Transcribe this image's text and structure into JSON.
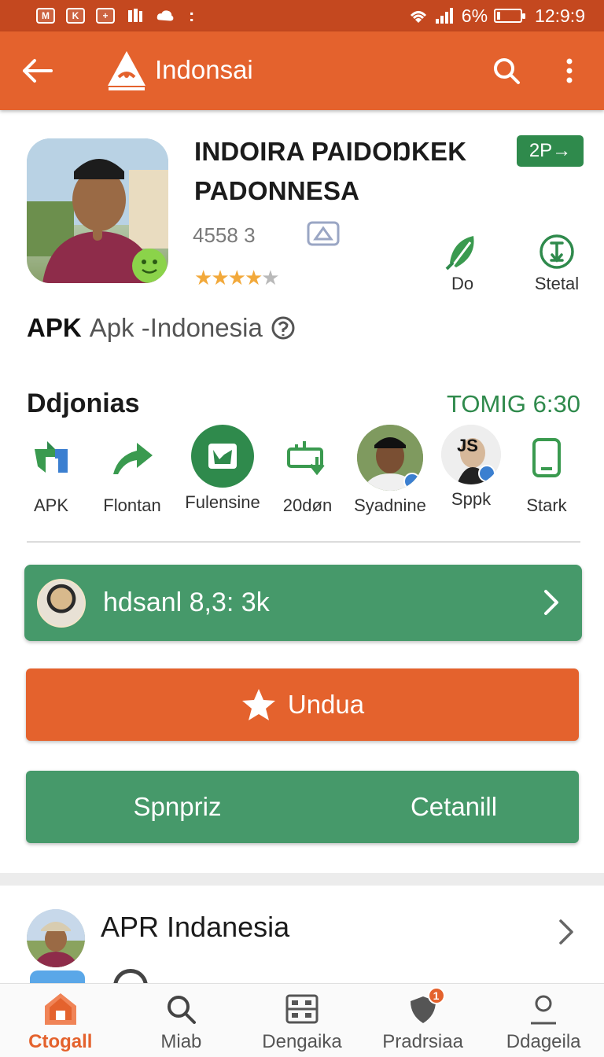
{
  "status_bar": {
    "time": "12:9:9",
    "battery": "6%",
    "left_icons": [
      "mail-icon",
      "calendar-icon",
      "plus-box-icon",
      "bookmark-icon",
      "cloud-icon"
    ],
    "more": ":"
  },
  "app_bar": {
    "title": "Indonsai",
    "back_icon": "arrow-left-icon",
    "search_icon": "search-icon",
    "more_icon": "more-vertical-icon"
  },
  "app": {
    "title": "INDOIRA PAIDOŊKEK PADONNESA",
    "badge": "2P→",
    "count": "4558 3",
    "rating_stars": 4,
    "rating_max": 5,
    "actions": [
      {
        "label": "Do",
        "icon": "leaf-pen-icon"
      },
      {
        "label": "Stetal",
        "icon": "install-circle-icon"
      }
    ]
  },
  "apk_line": {
    "bold": "APK",
    "text": "Apk -Indonesia"
  },
  "section": {
    "title": "Ddjonias",
    "time": "TOMIG 6:30",
    "shortcuts": [
      {
        "label": "APK",
        "icon": "apk-icon"
      },
      {
        "label": "Flontan",
        "icon": "share-arrow-icon"
      },
      {
        "label": "Fulensine",
        "icon": "image-circle-icon"
      },
      {
        "label": "20døn",
        "icon": "download-tray-icon"
      },
      {
        "label": "Syadnine",
        "icon": "avatar-man-icon"
      },
      {
        "label": "Sppk",
        "icon": "avatar-js-icon"
      },
      {
        "label": "Stark",
        "icon": "phone-icon"
      }
    ]
  },
  "green_bar": {
    "text": "hdsanl 8,3: 3k"
  },
  "download_button": {
    "label": "Undua"
  },
  "split_button": {
    "left": "Spnpriz",
    "right": "Cetanill"
  },
  "related": {
    "title": "APR Indanesia"
  },
  "bottom_nav": [
    {
      "label": "Ctogall",
      "icon": "home-icon",
      "active": true
    },
    {
      "label": "Miab",
      "icon": "search-icon"
    },
    {
      "label": "Dengaika",
      "icon": "grid-box-icon"
    },
    {
      "label": "Pradrsiaa",
      "icon": "shield-icon",
      "badge": "1"
    },
    {
      "label": "Ddageila",
      "icon": "person-icon"
    }
  ],
  "colors": {
    "primary_orange": "#e4622d",
    "status_orange": "#c4481f",
    "green": "#46996a",
    "dark_green": "#2f8a4c",
    "star": "#f2a93b"
  }
}
